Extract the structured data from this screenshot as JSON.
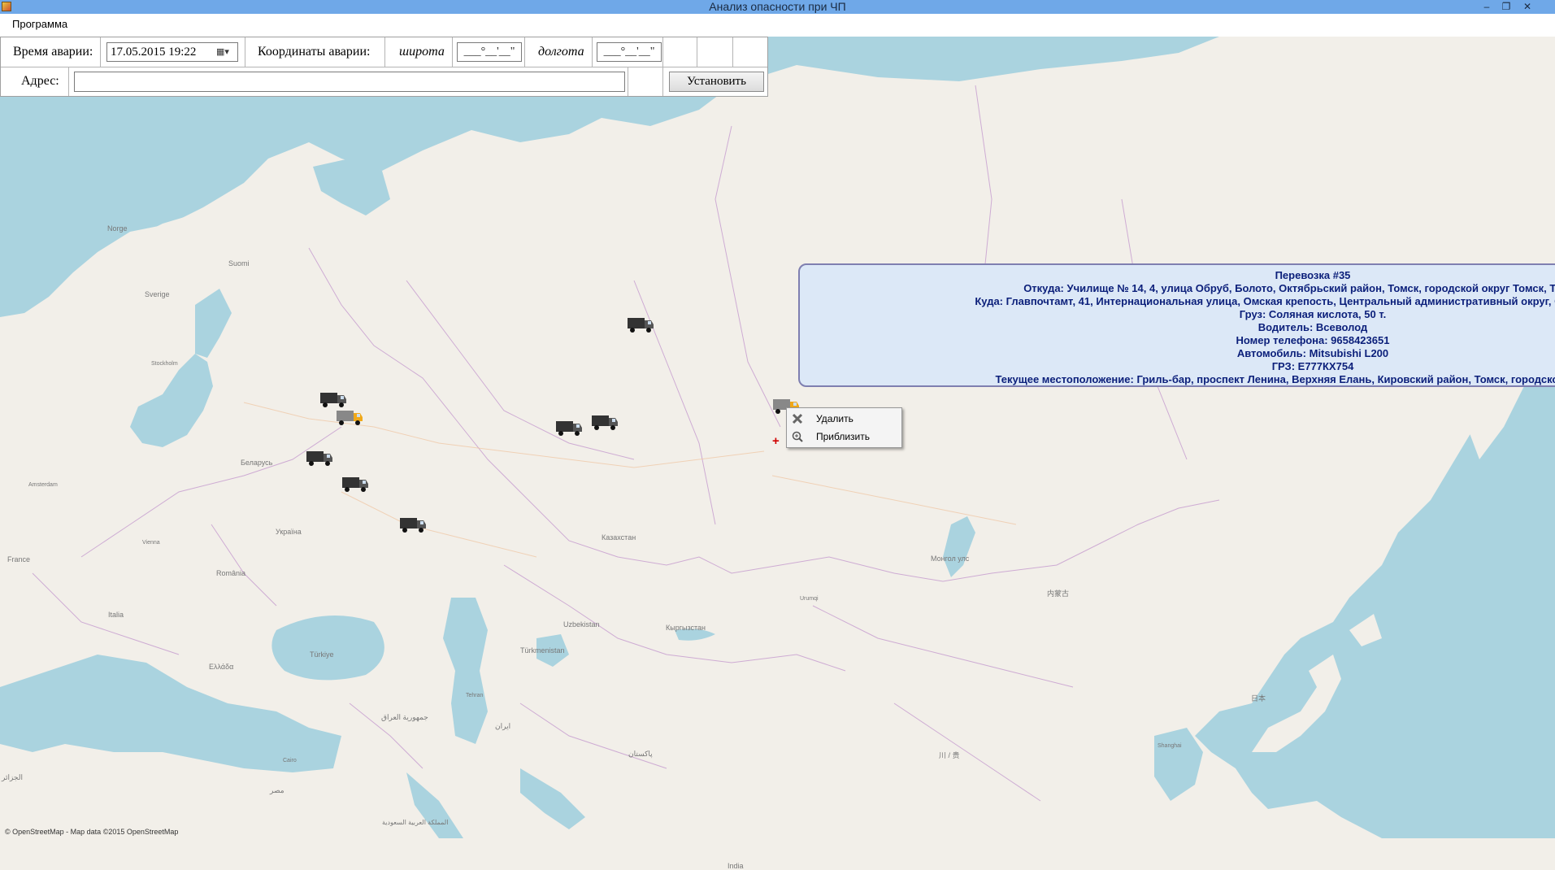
{
  "window": {
    "title": "Анализ опасности при ЧП"
  },
  "menu": {
    "program": "Программа"
  },
  "toolbar": {
    "accident_time_label": "Время аварии:",
    "accident_time_value": "17.05.2015 19:22",
    "coords_label": "Координаты аварии:",
    "latitude_label": "широта",
    "latitude_value": "___°__'__\"",
    "longitude_label": "долгота",
    "longitude_value": "___°__'__\"",
    "address_label": "Адрес:",
    "address_value": "",
    "set_button": "Установить"
  },
  "map_labels": {
    "norge": "Norge",
    "suomi": "Suomi",
    "sverige": "Sverige",
    "stockholm": "Stockholm",
    "belarus": "Беларусь",
    "ukraina": "Україна",
    "romania": "România",
    "france": "France",
    "kazakhstan": "Казахстан",
    "uzbekistan": "Uzbekistan",
    "turkmenistan": "Türkmenistan",
    "kyrgyzstan": "Кыргызстан",
    "mongolia": "Монгол улс",
    "turkiye": "Türkiye",
    "ellada": "Ελλάδα",
    "italia": "Italia",
    "iraq": "جمهورية العراق",
    "iran": "ایران",
    "pakistan": "پاکستان",
    "india": "India",
    "china_nm": "内蒙古",
    "china_sc": "川 / 贵",
    "japan": "日本",
    "tehran": "Tehran",
    "cairo": "Cairo",
    "misr": "مصر",
    "saudi": "المملكة العربية السعودية",
    "amsterdam": "Amsterdam",
    "vienna": "Vienna",
    "urumqi": "Urumqi",
    "shanghai": "Shanghai",
    "algeria": "الجزائر"
  },
  "attribution": "© OpenStreetMap - Map data ©2015 OpenStreetMap",
  "popup": {
    "title": "Перевозка #35",
    "from": "Откуда: Училище № 14, 4, улица Обруб, Болото, Октябрьский район, Томск, городской округ Томск, Томская о",
    "to": "Куда: Главпочтамт, 41, Интернациональная улица, Омская крепость, Центральный административный округ, Омск, городской о",
    "cargo": "Груз: Соляная кислота, 50 т.",
    "driver": "Водитель: Всеволод",
    "phone": "Номер телефона: 9658423651",
    "car": "Автомобиль: Mitsubishi L200",
    "plate": "ГРЗ: Е777КХ754",
    "location": "Текущее местоположение: Гриль-бар, проспект Ленина, Верхняя Елань, Кировский район, Томск, городской округ Томск"
  },
  "context_menu": {
    "delete": "Удалить",
    "zoom": "Приблизить"
  },
  "colors": {
    "water": "#aad3df",
    "land": "#f2efe9",
    "border": "#c8a0d0",
    "popup_bg": "#dce8f7",
    "popup_text": "#0b1f7a",
    "titlebar": "#6fa8e8"
  }
}
